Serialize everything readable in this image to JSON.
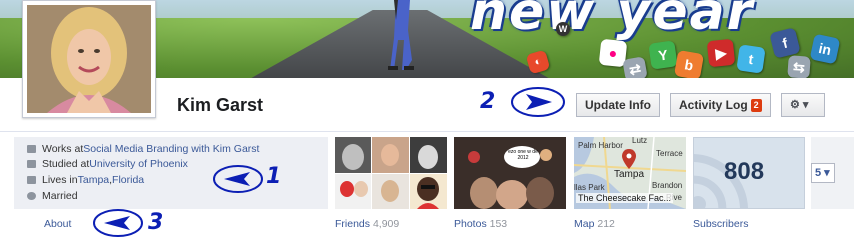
{
  "profile": {
    "name": "Kim Garst"
  },
  "cover": {
    "headline": "new year",
    "social_icons": [
      "in",
      "f",
      "t",
      "Y",
      "b"
    ]
  },
  "header": {
    "update_info": "Update Info",
    "activity_log": "Activity Log",
    "activity_badge": "2",
    "settings_caret": "⚙ ▾"
  },
  "annotations": {
    "one": "1",
    "two": "2",
    "three": "3"
  },
  "about": {
    "works_prefix": "Works at ",
    "works_link": "Social Media Branding with Kim Garst",
    "studied_prefix": "Studied at ",
    "studied_link": "University of Phoenix",
    "lives_prefix": "Lives in ",
    "lives_city": "Tampa",
    "lives_sep": ", ",
    "lives_state": "Florida",
    "relationship": "Married",
    "label": "About"
  },
  "tiles": {
    "friends_label": "Friends",
    "friends_count": "4,909",
    "photos_label": "Photos",
    "photos_count": "153",
    "photo_caption": "ezo one w de 2012",
    "map_label": "Map",
    "map_count": "212",
    "map_places": [
      "Palm Harbor",
      "Lutz",
      "Terrace",
      "Tampa",
      "Brandon",
      "llas Park",
      "Rive"
    ],
    "map_pin": "The Cheesecake Fac...",
    "subscribers_label": "Subscribers",
    "subscribers_count": "808"
  },
  "pager": {
    "value": "5 ▾"
  },
  "colors": {
    "link": "#3b5998",
    "badge": "#dd3c10",
    "annotation": "#0c1fb4"
  }
}
